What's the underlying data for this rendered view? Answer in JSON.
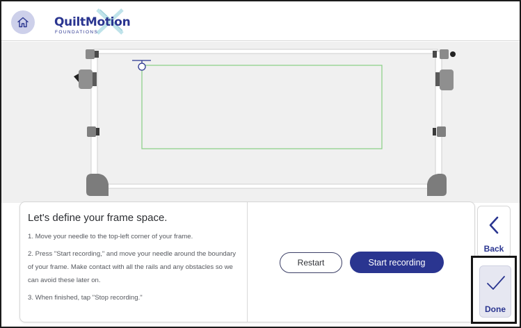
{
  "header": {
    "home_icon": "home-icon",
    "logo": {
      "word": "QuiltMotion",
      "sub": "FOUNDATIONS"
    }
  },
  "instructions": {
    "title": "Let's define your frame space.",
    "steps": [
      "1. Move your needle to the top-left corner of your frame.",
      "2. Press \"Start recording,\" and move your needle around the boundary of your frame. Make contact with all the rails and any obstacles so we can avoid these later on.",
      "3. When finished, tap \"Stop recording.\""
    ]
  },
  "actions": {
    "restart_label": "Restart",
    "record_label": "Start recording"
  },
  "nav": {
    "back_label": "Back",
    "done_label": "Done"
  },
  "colors": {
    "brand": "#2a3590",
    "home_bg": "#cdd0ea",
    "boundary_rect": "#8fd18a",
    "needle": "#2a3590",
    "canvas_bg": "#f0f0f0"
  }
}
